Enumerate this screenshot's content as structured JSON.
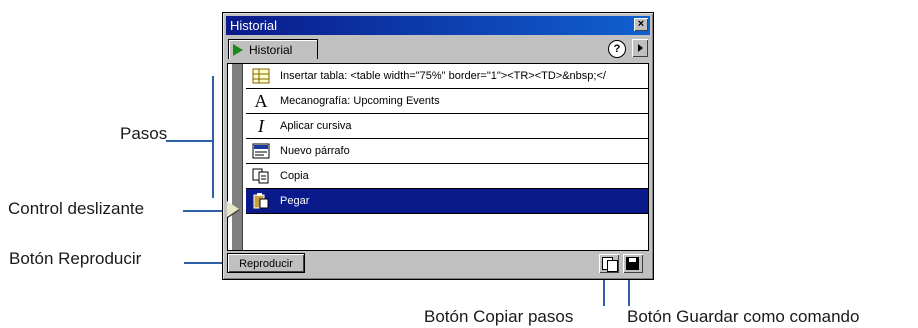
{
  "callouts": {
    "steps": "Pasos",
    "slider": "Control deslizante",
    "replay": "Botón Reproducir",
    "copy_steps": "Botón Copiar pasos",
    "save_command": "Botón Guardar como comando"
  },
  "window": {
    "title": "Historial",
    "close_glyph": "×",
    "tab_label": "Historial",
    "help_glyph": "?"
  },
  "steps": [
    {
      "icon": "table-icon",
      "label": "Insertar tabla: <table width=\"75%\" border=\"1\"><TR><TD>&nbsp;</"
    },
    {
      "icon": "typing-icon",
      "label": "Mecanografía: Upcoming Events"
    },
    {
      "icon": "italic-icon",
      "label": "Aplicar cursiva"
    },
    {
      "icon": "paragraph-icon",
      "label": "Nuevo párrafo"
    },
    {
      "icon": "copy-icon",
      "label": "Copia"
    },
    {
      "icon": "paste-icon",
      "label": "Pegar",
      "selected": true
    }
  ],
  "bottombar": {
    "replay_label": "Reproducir"
  },
  "colors": {
    "selection": "#0a1a8a",
    "callout_line": "#2f5fa7"
  }
}
